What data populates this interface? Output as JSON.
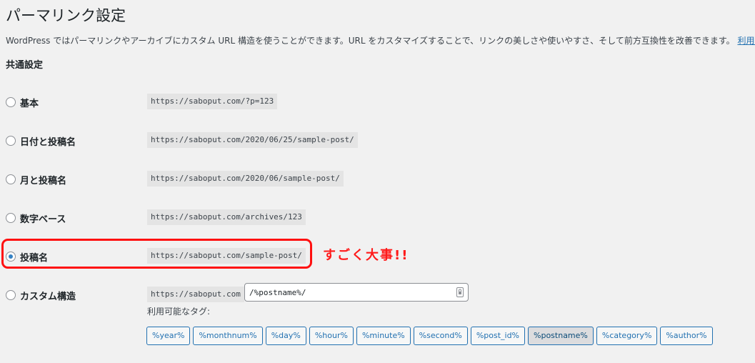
{
  "page": {
    "title": "パーマリンク設定",
    "intro": "WordPress ではパーマリンクやアーカイブにカスタム URL 構造を使うことができます。URL をカスタマイズすることで、リンクの美しさや使いやすさ、そして前方互換性を改善できます。",
    "intro_link": "利用できるタグ"
  },
  "common": {
    "title": "共通設定",
    "options": [
      {
        "label": "基本",
        "url": "https://saboput.com/?p=123",
        "checked": false
      },
      {
        "label": "日付と投稿名",
        "url": "https://saboput.com/2020/06/25/sample-post/",
        "checked": false
      },
      {
        "label": "月と投稿名",
        "url": "https://saboput.com/2020/06/sample-post/",
        "checked": false
      },
      {
        "label": "数字ベース",
        "url": "https://saboput.com/archives/123",
        "checked": false
      },
      {
        "label": "投稿名",
        "url": "https://saboput.com/sample-post/",
        "checked": true
      },
      {
        "label": "カスタム構造",
        "url": "https://saboput.com",
        "checked": false
      }
    ],
    "custom_value": "/%postname%/",
    "available_tags_label": "利用可能なタグ:",
    "tags": [
      {
        "label": "%year%",
        "active": false
      },
      {
        "label": "%monthnum%",
        "active": false
      },
      {
        "label": "%day%",
        "active": false
      },
      {
        "label": "%hour%",
        "active": false
      },
      {
        "label": "%minute%",
        "active": false
      },
      {
        "label": "%second%",
        "active": false
      },
      {
        "label": "%post_id%",
        "active": false
      },
      {
        "label": "%postname%",
        "active": true
      },
      {
        "label": "%category%",
        "active": false
      },
      {
        "label": "%author%",
        "active": false
      }
    ]
  },
  "annotation": {
    "text": "すごく大事!!",
    "color": "#ff1a1a"
  },
  "colors": {
    "accent": "#2271b1",
    "background": "#f1f1f1",
    "radio_checked": "#3582c4"
  }
}
